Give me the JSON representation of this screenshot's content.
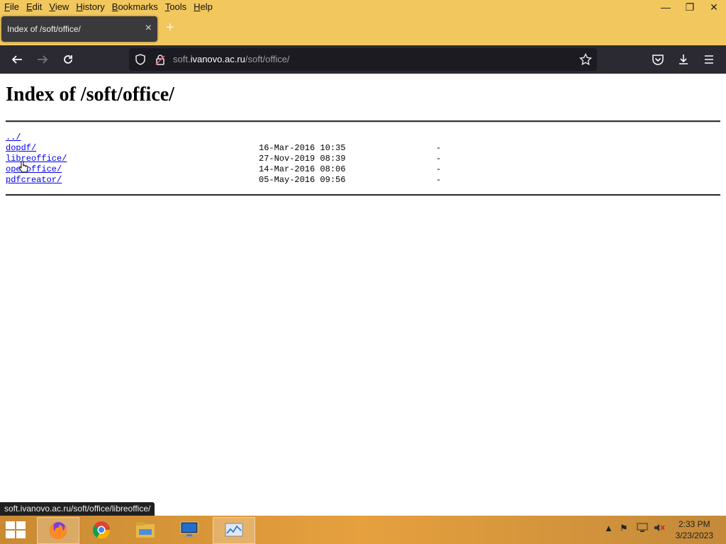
{
  "menubar": {
    "items": [
      "File",
      "Edit",
      "View",
      "History",
      "Bookmarks",
      "Tools",
      "Help"
    ],
    "controls": [
      "minimize-icon",
      "restore-icon",
      "close-icon"
    ]
  },
  "tab": {
    "title": "Index of /soft/office/",
    "close": "×",
    "new_tab": "+"
  },
  "toolbar": {
    "url_prefix": "soft.",
    "url_host": "ivanovo.ac.ru",
    "url_path": "/soft/office/"
  },
  "page": {
    "heading": "Index of /soft/office/",
    "parent_link": "../",
    "entries": [
      {
        "name": "dopdf/",
        "date": "16-Mar-2016 10:35",
        "size": "-"
      },
      {
        "name": "libreoffice/",
        "date": "27-Nov-2019 08:39",
        "size": "-"
      },
      {
        "name": "openoffice/",
        "date": "14-Mar-2016 08:06",
        "size": "-"
      },
      {
        "name": "pdfcreator/",
        "date": "05-May-2016 09:56",
        "size": "-"
      }
    ]
  },
  "status": {
    "link_preview": "soft.ivanovo.ac.ru/soft/office/libreoffice/"
  },
  "taskbar": {
    "time": "2:33 PM",
    "date": "3/23/2023",
    "accent": "#e6a03e"
  }
}
